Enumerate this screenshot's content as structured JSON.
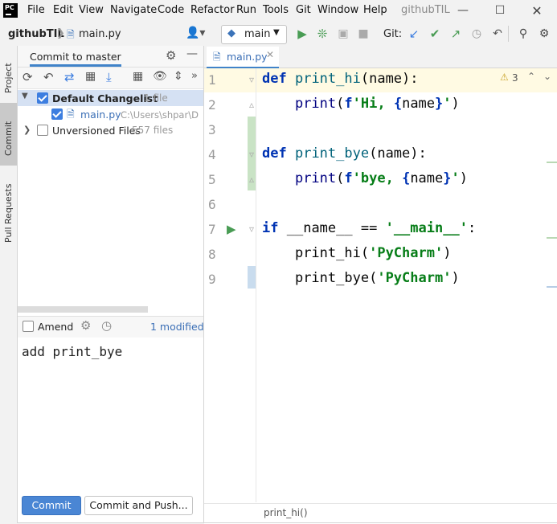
{
  "menubar": {
    "items": [
      "File",
      "Edit",
      "View",
      "Navigate",
      "Code",
      "Refactor",
      "Run",
      "Tools",
      "Git",
      "Window",
      "Help"
    ],
    "window_title": "githubTIL",
    "logo_text": "PC"
  },
  "navbar": {
    "project": "githubTIL",
    "file": "main.py",
    "branch": "main",
    "git_label": "Git:"
  },
  "stripe": {
    "tabs": [
      "Project",
      "Commit",
      "Pull Requests"
    ]
  },
  "commit_panel": {
    "title": "Commit to master",
    "changelist": {
      "name": "Default Changelist",
      "count": "1 file"
    },
    "file": {
      "name": "main.py",
      "path": "C:\\Users\\shpar\\D"
    },
    "unversioned": {
      "name": "Unversioned Files",
      "count": "557 files"
    },
    "amend_label": "Amend",
    "modified_label": "1 modified",
    "message": "add print_bye",
    "commit_button": "Commit",
    "commit_push_button": "Commit and Push..."
  },
  "editor": {
    "tab_name": "main.py",
    "warnings": "3",
    "breadcrumb": "print_hi()",
    "line_numbers": [
      "1",
      "2",
      "3",
      "4",
      "5",
      "6",
      "7",
      "8",
      "9"
    ],
    "lines": [
      {
        "kw": "def",
        "rest_fn": "print_hi",
        "rest": "(name):"
      },
      {
        "indent": "    ",
        "fn": "print",
        "a": "(",
        "f": "f",
        "s1": "'Hi, ",
        "b1": "{",
        "v": "name",
        "b2": "}",
        "s2": "'",
        "z": ")"
      },
      {},
      {
        "kw": "def",
        "rest_fn": "print_bye",
        "rest": "(name):"
      },
      {
        "indent": "    ",
        "fn": "print",
        "a": "(",
        "f": "f",
        "s1": "'bye, ",
        "b1": "{",
        "v": "name",
        "b2": "}",
        "s2": "'",
        "z": ")"
      },
      {},
      {
        "kw": "if",
        "sp": " ",
        "dunder": "__name__",
        "op": " == ",
        "s": "'__main__'",
        "z": ":"
      },
      {
        "indent": "    ",
        "call": "print_hi",
        "a": "(",
        "s": "'PyCharm'",
        "z": ")"
      },
      {
        "indent": "    ",
        "call": "print_bye",
        "a": "(",
        "s": "'PyCharm'",
        "z": ")"
      }
    ]
  },
  "colors": {
    "accent": "#3d7ee0",
    "run_green": "#499c54",
    "keyword": "#0033b3",
    "string": "#067d17",
    "dunder": "#b200b2"
  }
}
